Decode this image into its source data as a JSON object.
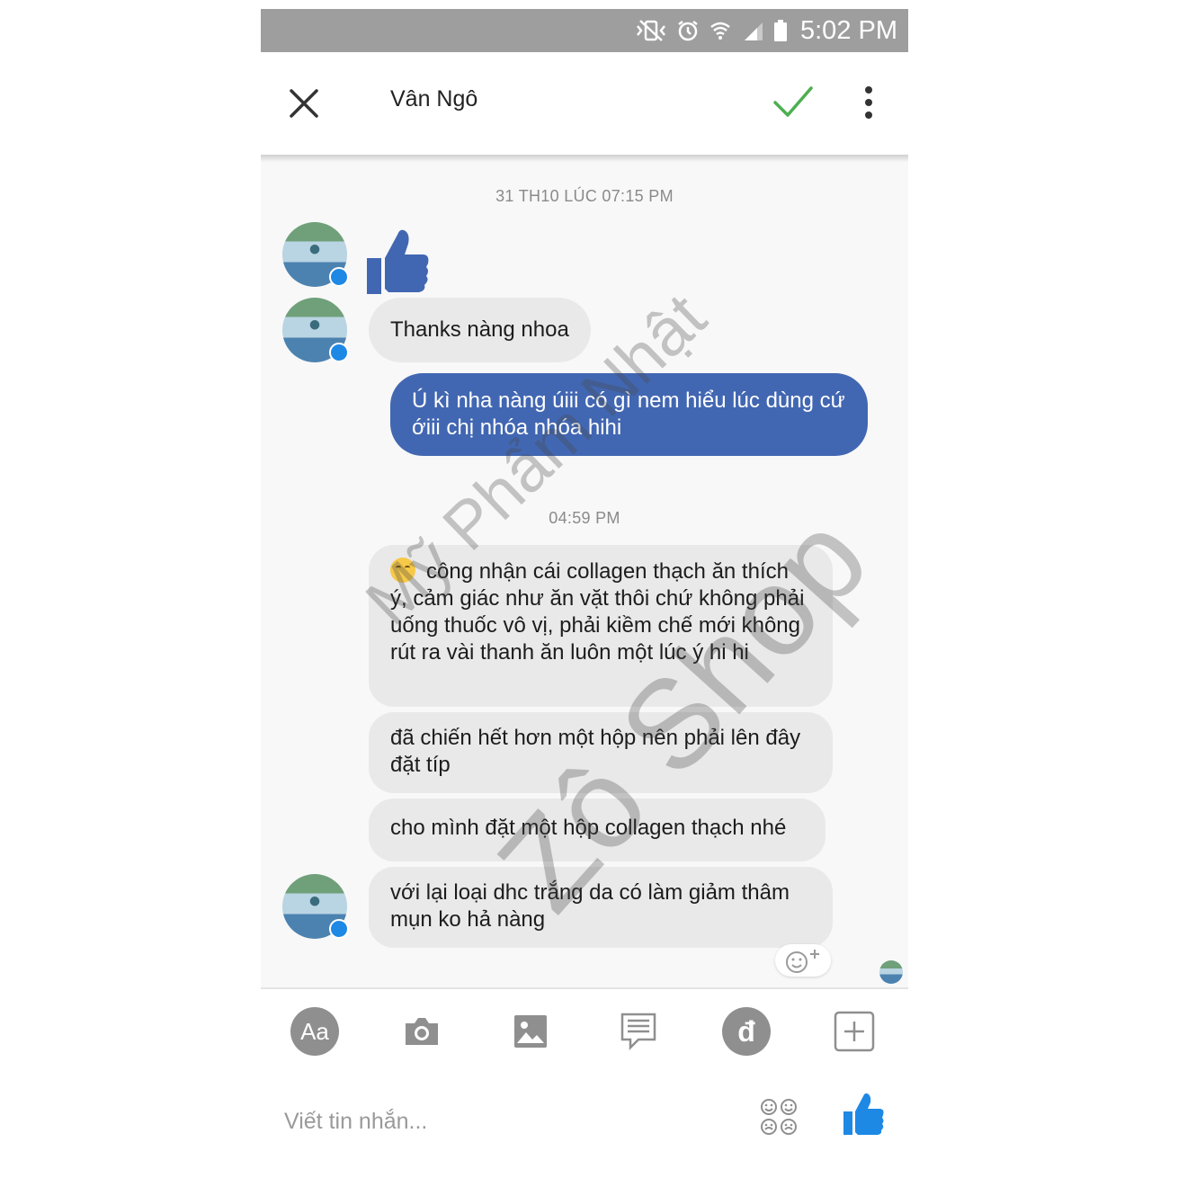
{
  "status_bar": {
    "time": "5:02 PM",
    "icons": [
      "vibrate-mute-icon",
      "alarm-icon",
      "wifi-icon",
      "signal-icon",
      "battery-icon"
    ]
  },
  "header": {
    "close_icon": "close-icon",
    "title": "Vân Ngô",
    "confirm_icon": "checkmark-icon",
    "menu_icon": "more-vertical-icon",
    "check_color": "#4caf50"
  },
  "conversation": {
    "timestamp_1": "31 TH10 LÚC 07:15 PM",
    "timestamp_2": "04:59 PM",
    "messages": [
      {
        "from": "contact",
        "type": "like-sticker",
        "text": ""
      },
      {
        "from": "contact",
        "type": "text",
        "text": "Thanks nàng nhoa"
      },
      {
        "from": "me",
        "type": "text",
        "text": "Ú kì nha nàng úiii có gì nem hiểu lúc dùng cứ ớiii chị nhóa nhóa hihi"
      },
      {
        "from": "contact",
        "type": "text",
        "text": "công nhận cái collagen thạch ăn thích ý, cảm giác như ăn vặt thôi chứ không phải uống thuốc vô vị, phải kiềm chế mới không rút ra vài thanh ăn luôn một lúc ý hi hi"
      },
      {
        "from": "contact",
        "type": "text",
        "text": "đã chiến hết hơn một hộp nên phải lên đây đặt típ"
      },
      {
        "from": "contact",
        "type": "text",
        "text": "cho mình đặt một hộp collagen thạch nhé"
      },
      {
        "from": "contact",
        "type": "text",
        "text": "với lại loại dhc trắng da có làm giảm thâm mụn ko hả nàng"
      }
    ],
    "outgoing_color": "#4267b2",
    "incoming_color": "#e9e9e9"
  },
  "watermark": {
    "line_1": "Mỹ Phẩm Nhật",
    "line_2": "Zô Shop"
  },
  "toolbar": {
    "text_button_label": "Aa",
    "payment_button_label": "đ",
    "icons": [
      "text-style-icon",
      "camera-icon",
      "gallery-icon",
      "quick-reply-icon",
      "payment-icon",
      "more-plus-icon"
    ]
  },
  "composer": {
    "placeholder": "Viết tin nhắn...",
    "sticker_icon": "sticker-icon",
    "send_icon": "like-icon",
    "like_color": "#1e88e5"
  }
}
